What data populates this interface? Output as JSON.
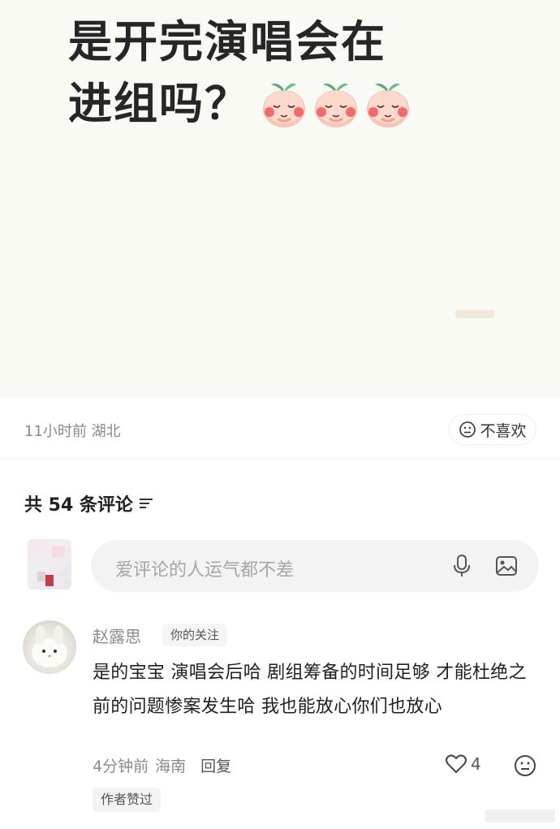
{
  "post": {
    "line1": "是开完演唱会在",
    "line2": "进组吗？",
    "emoji_names": [
      "peach-face-emoji",
      "peach-face-emoji",
      "peach-face-emoji"
    ]
  },
  "meta": {
    "time_location": "11小时前 湖北",
    "dislike_label": "不喜欢"
  },
  "comments_header": {
    "label": "共 54 条评论"
  },
  "comment_input": {
    "placeholder": "爱评论的人运气都不差"
  },
  "comment": {
    "author": "赵露思",
    "follow_tag": "你的关注",
    "body": "是的宝宝 演唱会后哈 剧组筹备的时间足够 才能杜绝之前的问题惨案发生哈 我也能放心你们也放心",
    "time": "4分钟前",
    "location": "海南",
    "reply_label": "回复",
    "likes": "4",
    "author_liked_tag": "作者赞过"
  },
  "colors": {
    "post_bg": "#fafaf4",
    "text_primary": "#262626",
    "text_secondary": "#8a8a8a",
    "input_bg": "#f3f3f3"
  }
}
